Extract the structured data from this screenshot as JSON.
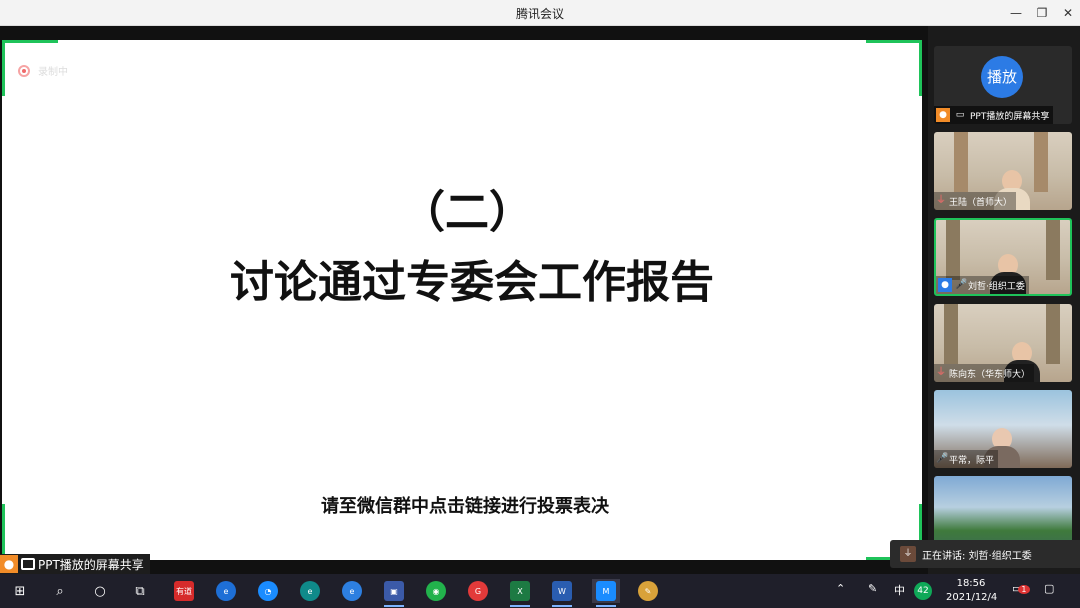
{
  "window": {
    "title": "腾讯会议"
  },
  "recording": {
    "label": "录制中"
  },
  "slide": {
    "number": "（二）",
    "title": "讨论通过专委会工作报告",
    "note": "请至微信群中点击链接进行投票表决"
  },
  "share_label": "PPT播放的屏幕共享",
  "participants": [
    {
      "type": "play",
      "button": "播放",
      "label": "PPT播放的屏幕共享"
    },
    {
      "name": "王陆（首师大）",
      "mic": "muted"
    },
    {
      "name": "刘哲·组织工委",
      "mic": "on",
      "active": true
    },
    {
      "name": "陈向东（华东师大）",
      "mic": "muted"
    },
    {
      "name": "平常，际平",
      "mic": "on"
    },
    {
      "name": "",
      "mic": ""
    }
  ],
  "speaking": {
    "text": "正在讲话: 刘哲·组织工委"
  },
  "taskbar": {
    "time": "18:56",
    "date": "2021/12/4",
    "ime": "中",
    "badge": "42",
    "notification_count": "1",
    "apps": [
      {
        "icon": "windows-start-icon"
      },
      {
        "icon": "search-icon"
      },
      {
        "icon": "cortana-icon"
      },
      {
        "icon": "task-view-icon"
      },
      {
        "icon": "youdao-icon",
        "label": "有道"
      },
      {
        "icon": "ie-icon"
      },
      {
        "icon": "tencent-meeting-icon"
      },
      {
        "icon": "edge-icon"
      },
      {
        "icon": "ie-alt-icon"
      },
      {
        "icon": "save-icon"
      },
      {
        "icon": "wechat-icon"
      },
      {
        "icon": "weibo-icon"
      },
      {
        "icon": "excel-icon"
      },
      {
        "icon": "word-icon"
      },
      {
        "icon": "tencent-meeting-active-icon"
      },
      {
        "icon": "paint-icon"
      }
    ]
  },
  "colors": {
    "accent_green": "#1fc35a",
    "play_blue": "#2c7be5",
    "share_orange": "#f28c28"
  }
}
